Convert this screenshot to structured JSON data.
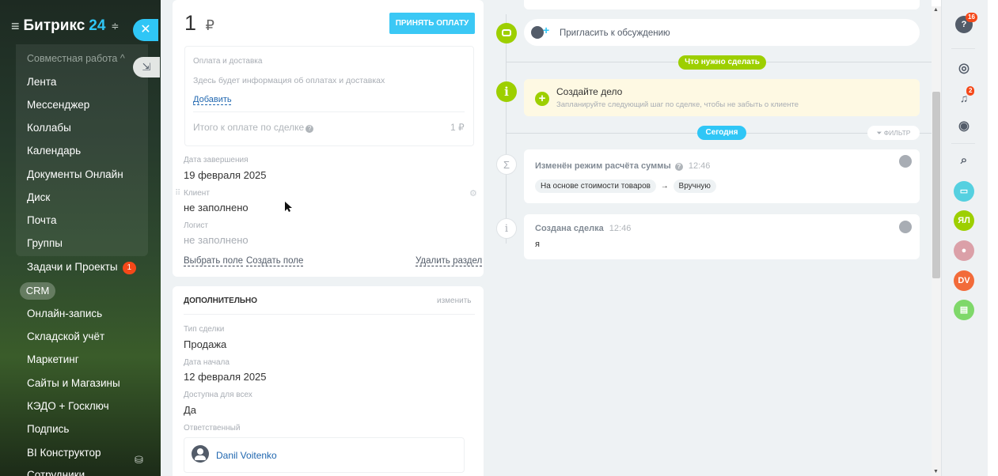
{
  "sidebar": {
    "brand": "Битрикс",
    "brand_num": "24",
    "items": [
      {
        "label": "Совместная работа ^"
      },
      {
        "label": "Лента"
      },
      {
        "label": "Мессенджер"
      },
      {
        "label": "Коллабы"
      },
      {
        "label": "Календарь"
      },
      {
        "label": "Документы Онлайн"
      },
      {
        "label": "Диск"
      },
      {
        "label": "Почта"
      },
      {
        "label": "Группы"
      },
      {
        "label": "Задачи и Проекты",
        "badge": "1"
      },
      {
        "label": "CRM"
      },
      {
        "label": "Онлайн-запись"
      },
      {
        "label": "Складской учёт"
      },
      {
        "label": "Маркетинг"
      },
      {
        "label": "Сайты и Магазины"
      },
      {
        "label": "КЭДО + Госключ"
      },
      {
        "label": "Подпись"
      },
      {
        "label": "BI Конструктор"
      },
      {
        "label": "Сотрудники"
      }
    ]
  },
  "payment": {
    "amount": "1",
    "currency": "₽",
    "accept_button": "ПРИНЯТЬ ОПЛАТУ",
    "section_title": "Оплата и доставка",
    "section_info": "Здесь будет информация об оплатах и доставках",
    "add_link": "Добавить",
    "total_label": "Итого к оплате по сделке",
    "total_value": "1 ₽"
  },
  "fields": {
    "end_date_label": "Дата завершения",
    "end_date_value": "19 февраля 2025",
    "client_label": "Клиент",
    "client_value": "не заполнено",
    "logist_label": "Логист",
    "logist_value": "не заполнено",
    "choose_field": "Выбрать поле",
    "create_field": "Создать поле",
    "delete_section": "Удалить раздел"
  },
  "additional": {
    "title": "ДОПОЛНИТЕЛЬНО",
    "edit": "изменить",
    "deal_type_label": "Тип сделки",
    "deal_type_value": "Продажа",
    "start_date_label": "Дата начала",
    "start_date_value": "12 февраля 2025",
    "public_label": "Доступна для всех",
    "public_value": "Да",
    "responsible_label": "Ответственный",
    "responsible_name": "Danil Voitenko"
  },
  "timeline": {
    "invite": "Пригласить к обсуждению",
    "todo_pill": "Что нужно сделать",
    "task_title": "Создайте дело",
    "task_desc": "Запланируйте следующий шаг по сделке, чтобы не забыть о клиенте",
    "today_pill": "Сегодня",
    "filter": "ФИЛЬТР",
    "event1_title": "Изменён режим расчёта суммы",
    "event1_time": "12:46",
    "event1_from": "На основе стоимости товаров",
    "event1_arrow": "→",
    "event1_to": "Вручную",
    "event2_title": "Создана сделка",
    "event2_time": "12:46",
    "event2_body": "я"
  },
  "right_bar": {
    "help_badge": "16",
    "bell_badge": "2",
    "user_initials": "ЯЛ",
    "dv_initials": "DV"
  },
  "colors": {
    "accent": "#2fc6f6",
    "green": "#9dcf00",
    "orange": "#f54819"
  }
}
